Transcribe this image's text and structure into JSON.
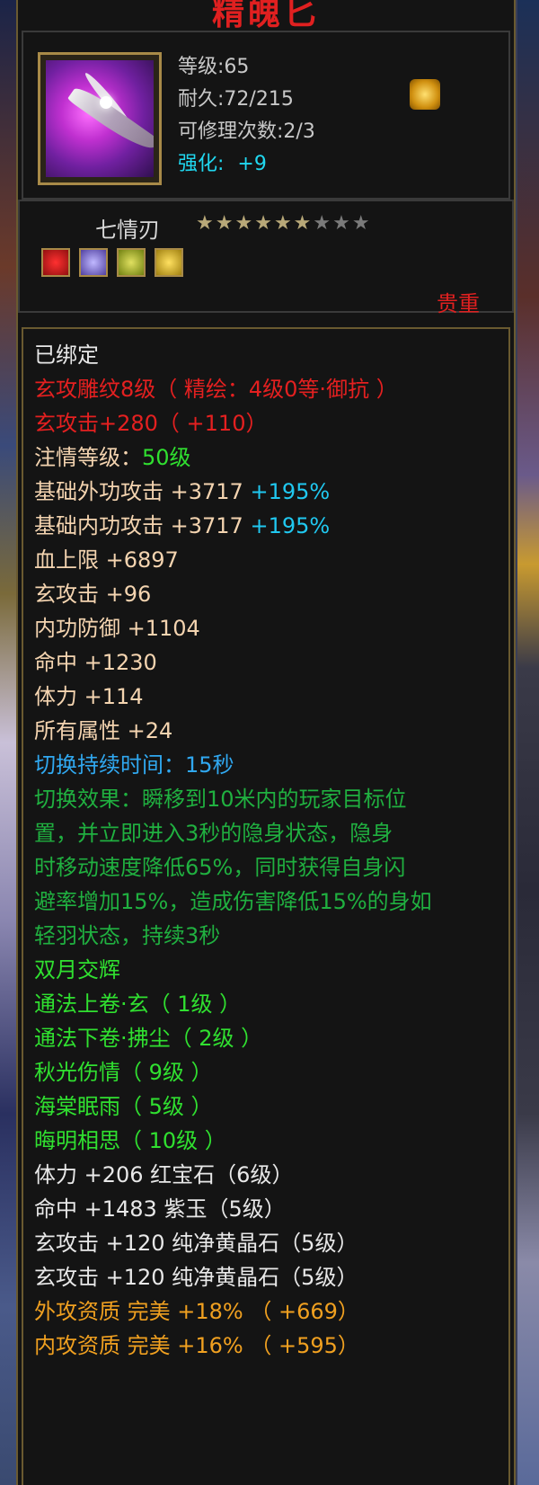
{
  "title": "精魄匕",
  "header": {
    "level": "等级:65",
    "durability": "耐久:72/215",
    "repair": "可修理次数:2/3",
    "enhance_label": "强化:",
    "enhance_value": "+9"
  },
  "item": {
    "name": "七情刃",
    "stars_total": 9,
    "stars_filled": 6,
    "rarity": "贵重",
    "sockets": [
      {
        "color": "#d01818",
        "glyph": "符"
      },
      {
        "color": "#8a7ae8",
        "glyph": "紫"
      },
      {
        "color": "#b8c020",
        "glyph": "晶"
      },
      {
        "color": "#d8c020",
        "glyph": "晶"
      }
    ]
  },
  "attrs": {
    "bound": "已绑定",
    "engrave": "玄攻雕纹8级（ 精绘：4级0等·御抗 ）",
    "xuan_attack": "玄攻击+280（ +110）",
    "zhuqing_label": "注情等级：",
    "zhuqing_value": "50级",
    "outer_attack_label": "基础外功攻击 +3717",
    "outer_attack_pct": "+195%",
    "inner_attack_label": "基础内功攻击 +3717",
    "inner_attack_pct": "+195%",
    "hp": "血上限 +6897",
    "xuan_atk2": "玄攻击 +96",
    "inner_def": "内功防御 +1104",
    "hit": "命中 +1230",
    "stamina": "体力 +114",
    "all_attr": "所有属性 +24",
    "switch_duration": "切换持续时间：15秒",
    "switch_effect_1": "切换效果：瞬移到10米内的玩家目标位",
    "switch_effect_2": "置，并立即进入3秒的隐身状态，隐身",
    "switch_effect_3": "时移动速度降低65%，同时获得自身闪",
    "switch_effect_4": "避率增加15%，造成伤害降低15%的身如",
    "switch_effect_5": "轻羽状态，持续3秒",
    "skill_set": "双月交辉",
    "skill_1": "通法上卷·玄（ 1级 ）",
    "skill_2": "通法下卷·拂尘（ 2级 ）",
    "skill_3": "秋光伤情（ 9级 ）",
    "skill_4": "海棠眠雨（ 5级 ）",
    "skill_5": "晦明相思（ 10级 ）",
    "gem_1": "体力 +206 红宝石（6级）",
    "gem_2": "命中 +1483 紫玉（5级）",
    "gem_3": "玄攻击 +120 纯净黄晶石（5级）",
    "gem_4": "玄攻击 +120 纯净黄晶石（5级）",
    "quality_outer": "外攻资质    完美 +18% （ +669）",
    "quality_inner": "内攻资质    完美 +16% （ +595）"
  }
}
